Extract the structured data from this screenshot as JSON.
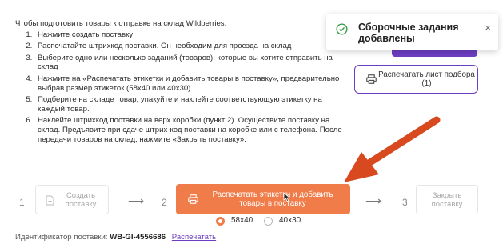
{
  "instructions": {
    "intro": "Чтобы подготовить товары к отправке на склад Wildberries:",
    "steps": [
      "Нажмите создать поставку",
      "Распечатайте штрихкод поставки. Он необходим для проезда на склад",
      "Выберите одно или несколько заданий (товаров), которые вы хотите отправить на склад",
      "Нажмите на «Распечатать этикетки и добавить товары в поставку», предварительно выбрав размер этикеток (58х40 или 40х30)",
      "Подберите на складе товар, упакуйте и наклейте соответствующую этикетку на каждый товар.",
      "Наклейте штрихкод поставки на верх коробки (пункт 2). Осуществите поставку на склад. Предъявите при сдаче штрих-код поставки на коробке или с телефона. После передачи товаров на склад, нажмите «Закрыть поставку»."
    ]
  },
  "toast": {
    "text": "Сборочные задания добавлены",
    "close": "×"
  },
  "print_sheet_button": {
    "label": "Распечатать лист подбора (1)"
  },
  "stepper": {
    "step1": {
      "number": "1",
      "label": "Создать поставку"
    },
    "step2": {
      "number": "2",
      "label": "Распечатать этикетки и добавить товары в поставку"
    },
    "step3": {
      "number": "3",
      "label": "Закрыть поставку"
    },
    "arrow": "⟶"
  },
  "label_size": {
    "options": [
      "58х40",
      "40х30"
    ],
    "selected": "58х40"
  },
  "footer": {
    "id_label": "Идентификатор поставки:",
    "id_value": "WB-GI-4556686",
    "print_link": "Распечатать"
  },
  "colors": {
    "accent_purple": "#6e3ec2",
    "accent_orange": "#f07c4a",
    "annotation_arrow": "#d8491f",
    "success_green": "#2e9a3e"
  }
}
